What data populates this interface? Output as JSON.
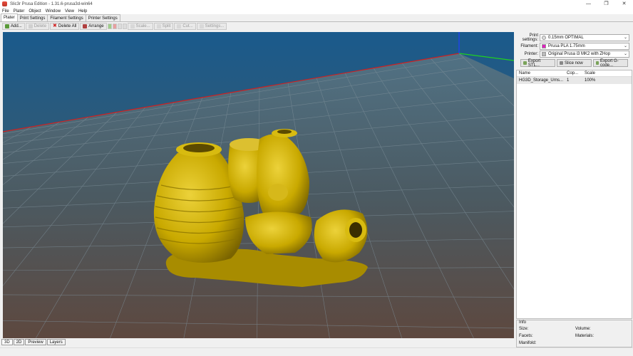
{
  "window": {
    "title": "Slic3r Prusa Edition - 1.31.6-prusa3d-win64"
  },
  "menu": [
    "File",
    "Plater",
    "Object",
    "Window",
    "View",
    "Help"
  ],
  "tabs": [
    "Plater",
    "Print Settings",
    "Filament Settings",
    "Printer Settings"
  ],
  "toolbar": {
    "add": "Add...",
    "delete": "Delete",
    "delete_all": "Delete All",
    "arrange": "Arrange",
    "scale": "Scale...",
    "split": "Split",
    "cut": "Cut...",
    "settings": "Settings..."
  },
  "settings": {
    "print_label": "Print settings:",
    "print_value": "0.15mm OPTIMAL",
    "filament_label": "Filament:",
    "filament_value": "Prusa PLA 1.75mm",
    "filament_color": "#e020c0",
    "printer_label": "Printer:",
    "printer_value": "Original Prusa i3 MK2 with ZHop"
  },
  "actions": {
    "export_stl": "Export STL...",
    "slice_now": "Slice now",
    "export_gcode": "Export G-code..."
  },
  "objects": {
    "headers": [
      "Name",
      "Cop...",
      "Scale"
    ],
    "rows": [
      {
        "name": "HG3D_Storage_Urns...",
        "copies": "1",
        "scale": "100%"
      }
    ]
  },
  "info": {
    "title": "Info",
    "size": "Size:",
    "volume": "Volume:",
    "facets": "Facets:",
    "materials": "Materials:",
    "manifold": "Manifold:"
  },
  "view_tabs": [
    "3D",
    "2D",
    "Preview",
    "Layers"
  ],
  "colors": {
    "model": "#c9a900",
    "bed_top": "#1a5a8c",
    "bed_bottom": "#5a3e2e"
  }
}
